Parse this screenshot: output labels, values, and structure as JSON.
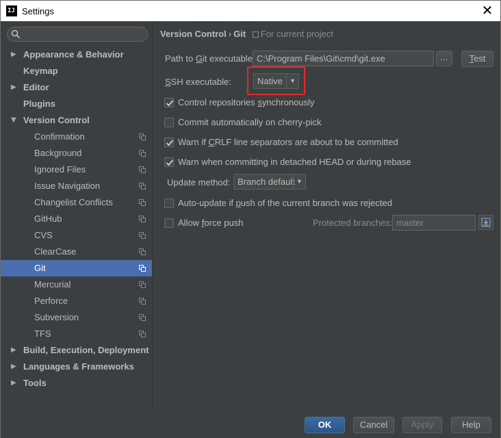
{
  "window": {
    "title": "Settings",
    "icon_text": "IJ"
  },
  "search": {
    "placeholder": ""
  },
  "sidebar": {
    "items": [
      {
        "label": "Appearance & Behavior",
        "level": 0,
        "arrow": "collapsed"
      },
      {
        "label": "Keymap",
        "level": 0,
        "arrow": "none"
      },
      {
        "label": "Editor",
        "level": 0,
        "arrow": "collapsed"
      },
      {
        "label": "Plugins",
        "level": 0,
        "arrow": "none"
      },
      {
        "label": "Version Control",
        "level": 0,
        "arrow": "expanded"
      },
      {
        "label": "Confirmation",
        "level": 1
      },
      {
        "label": "Background",
        "level": 1
      },
      {
        "label": "Ignored Files",
        "level": 1
      },
      {
        "label": "Issue Navigation",
        "level": 1
      },
      {
        "label": "Changelist Conflicts",
        "level": 1
      },
      {
        "label": "GitHub",
        "level": 1
      },
      {
        "label": "CVS",
        "level": 1
      },
      {
        "label": "ClearCase",
        "level": 1
      },
      {
        "label": "Git",
        "level": 1,
        "selected": true
      },
      {
        "label": "Mercurial",
        "level": 1
      },
      {
        "label": "Perforce",
        "level": 1
      },
      {
        "label": "Subversion",
        "level": 1
      },
      {
        "label": "TFS",
        "level": 1
      },
      {
        "label": "Build, Execution, Deployment",
        "level": 0,
        "arrow": "collapsed"
      },
      {
        "label": "Languages & Frameworks",
        "level": 0,
        "arrow": "collapsed"
      },
      {
        "label": "Tools",
        "level": 0,
        "arrow": "collapsed"
      }
    ]
  },
  "breadcrumb": {
    "parent": "Version Control",
    "separator": "›",
    "current": "Git",
    "scope": "For current project"
  },
  "git": {
    "path_label_pre": "Path to ",
    "path_label_u": "G",
    "path_label_post": "it executable:",
    "path_value": "C:\\Program Files\\Git\\cmd\\git.exe",
    "browse_label": "...",
    "test_label_u": "T",
    "test_label_post": "est",
    "ssh_label_u": "S",
    "ssh_label_post": "SH executable:",
    "ssh_value": "Native",
    "options": [
      {
        "pre": "Control repositories ",
        "u": "s",
        "post": "ynchronously",
        "checked": true
      },
      {
        "pre": "Commit automatically on cherry-pick",
        "u": "",
        "post": "",
        "checked": false
      },
      {
        "pre": "Warn if ",
        "u": "C",
        "post": "RLF line separators are about to be committed",
        "checked": true
      },
      {
        "pre": "Warn when committing in detached HEAD or during rebase",
        "u": "",
        "post": "",
        "checked": true
      }
    ],
    "update_method_label": "Update method:",
    "update_method_value": "Branch default",
    "auto_update": {
      "pre": "Auto-update if ",
      "u": "p",
      "post": "ush of the current branch was rejected",
      "checked": false
    },
    "allow_force": {
      "pre": "Allow ",
      "u": "f",
      "post": "orce push",
      "checked": false
    },
    "protected_label": "Protected branches:",
    "protected_value": "master"
  },
  "footer": {
    "ok": "OK",
    "cancel": "Cancel",
    "apply": "Apply",
    "help": "Help"
  },
  "colors": {
    "background": "#3c3f41",
    "selection": "#4b6eaf",
    "highlight_box": "#e02b2b",
    "default_button": "#365880"
  }
}
